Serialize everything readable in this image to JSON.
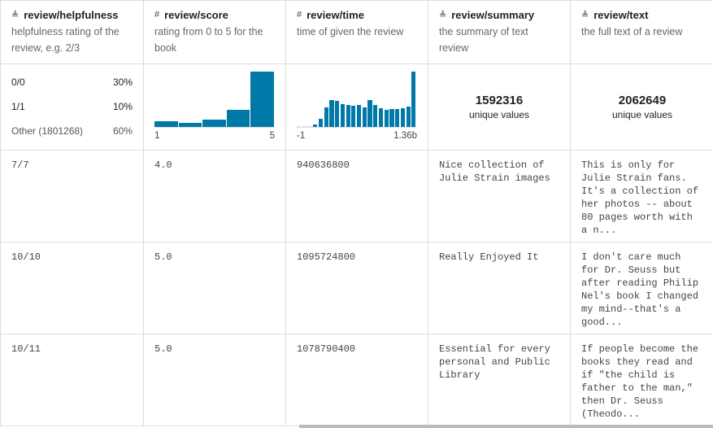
{
  "columns": [
    {
      "icon": "text-icon",
      "icon_glyph": "≜",
      "name": "review/helpfulness",
      "description": "helpfulness rating of the review, e.g. 2/3"
    },
    {
      "icon": "number-icon",
      "icon_glyph": "#",
      "name": "review/score",
      "description": "rating from 0 to 5 for the book"
    },
    {
      "icon": "number-icon",
      "icon_glyph": "#",
      "name": "review/time",
      "description": "time of given the review"
    },
    {
      "icon": "text-icon",
      "icon_glyph": "≜",
      "name": "review/summary",
      "description": "the summary of text review"
    },
    {
      "icon": "text-icon",
      "icon_glyph": "≜",
      "name": "review/text",
      "description": "the full text of a review"
    }
  ],
  "helpfulness_stats": [
    {
      "label": "0/0",
      "pct": "30%"
    },
    {
      "label": "1/1",
      "pct": "10%"
    },
    {
      "label": "Other (1801268)",
      "pct": "60%"
    }
  ],
  "score_hist": {
    "min": "1",
    "max": "5",
    "values": [
      22,
      15,
      28,
      64,
      205
    ]
  },
  "time_hist": {
    "min": "-1",
    "max": "1.36b",
    "values": [
      1,
      1,
      1,
      8,
      31,
      73,
      100,
      95,
      83,
      80,
      77,
      80,
      73,
      100,
      80,
      68,
      62,
      65,
      65,
      70,
      76,
      203
    ]
  },
  "summary_unique": {
    "count": "1592316",
    "label": "unique values"
  },
  "text_unique": {
    "count": "2062649",
    "label": "unique values"
  },
  "rows": [
    {
      "helpfulness": "7/7",
      "score": "4.0",
      "time": "940636800",
      "summary": "Nice collection of Julie Strain images",
      "text": "This is only for Julie Strain fans. It's a collection of her photos -- about 80 pages worth with a n..."
    },
    {
      "helpfulness": "10/10",
      "score": "5.0",
      "time": "1095724800",
      "summary": "Really Enjoyed It",
      "text": "I don't care much for Dr. Seuss but after reading Philip Nel's book I changed my mind--that's a good..."
    },
    {
      "helpfulness": "10/11",
      "score": "5.0",
      "time": "1078790400",
      "summary": "Essential for every personal and Public Library",
      "text": "If people become the books they read and if \"the child is father to the man,\" then Dr. Seuss (Theodo..."
    }
  ],
  "colors": {
    "bar": "#0079a8",
    "border": "#dddddd"
  }
}
